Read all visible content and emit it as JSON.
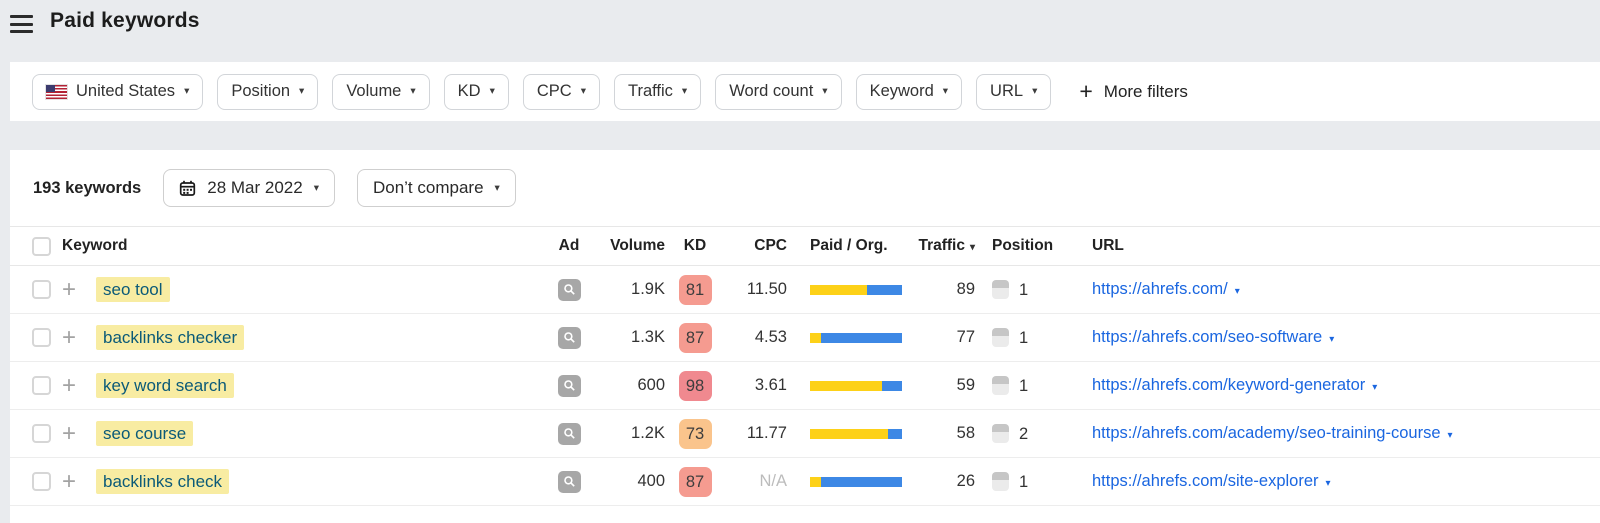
{
  "header": {
    "title": "Paid keywords"
  },
  "icons": {
    "caret_down": "▾",
    "plus": "+"
  },
  "filters": {
    "country": "United States",
    "buttons": [
      "Position",
      "Volume",
      "KD",
      "CPC",
      "Traffic",
      "Word count",
      "Keyword",
      "URL"
    ],
    "more_filters": "More filters"
  },
  "toolbar": {
    "keywords_count": "193 keywords",
    "date": "28 Mar 2022",
    "compare": "Don’t compare"
  },
  "table": {
    "columns": [
      "Keyword",
      "Ad",
      "Volume",
      "KD",
      "CPC",
      "Paid / Org.",
      "Traffic",
      "Position",
      "URL"
    ],
    "rows": [
      {
        "keyword": "seo tool",
        "volume": "1.9K",
        "kd": "81",
        "kd_color": "#f59b90",
        "cpc": "11.50",
        "paid_pct": 62,
        "traffic": "89",
        "position": "1",
        "url": "https://ahrefs.com/"
      },
      {
        "keyword": "backlinks checker",
        "volume": "1.3K",
        "kd": "87",
        "kd_color": "#f59b90",
        "cpc": "4.53",
        "paid_pct": 12,
        "traffic": "77",
        "position": "1",
        "url": "https://ahrefs.com/seo-software"
      },
      {
        "keyword": "key word search",
        "volume": "600",
        "kd": "98",
        "kd_color": "#f0898f",
        "cpc": "3.61",
        "paid_pct": 78,
        "traffic": "59",
        "position": "1",
        "url": "https://ahrefs.com/keyword-generator"
      },
      {
        "keyword": "seo course",
        "volume": "1.2K",
        "kd": "73",
        "kd_color": "#fac48c",
        "cpc": "11.77",
        "paid_pct": 85,
        "traffic": "58",
        "position": "2",
        "url": "https://ahrefs.com/academy/seo-training-course"
      },
      {
        "keyword": "backlinks check",
        "volume": "400",
        "kd": "87",
        "kd_color": "#f59b90",
        "cpc": "N/A",
        "paid_pct": 12,
        "traffic": "26",
        "position": "1",
        "url": "https://ahrefs.com/site-explorer"
      }
    ]
  },
  "colors": {
    "paid_bar": "#fdd118",
    "organic_bar": "#3d88e5",
    "link_blue": "#1a66e0",
    "keyword_highlight": "#f8eca2",
    "keyword_text": "#0b5a78",
    "page_background": "#e9ebee"
  }
}
